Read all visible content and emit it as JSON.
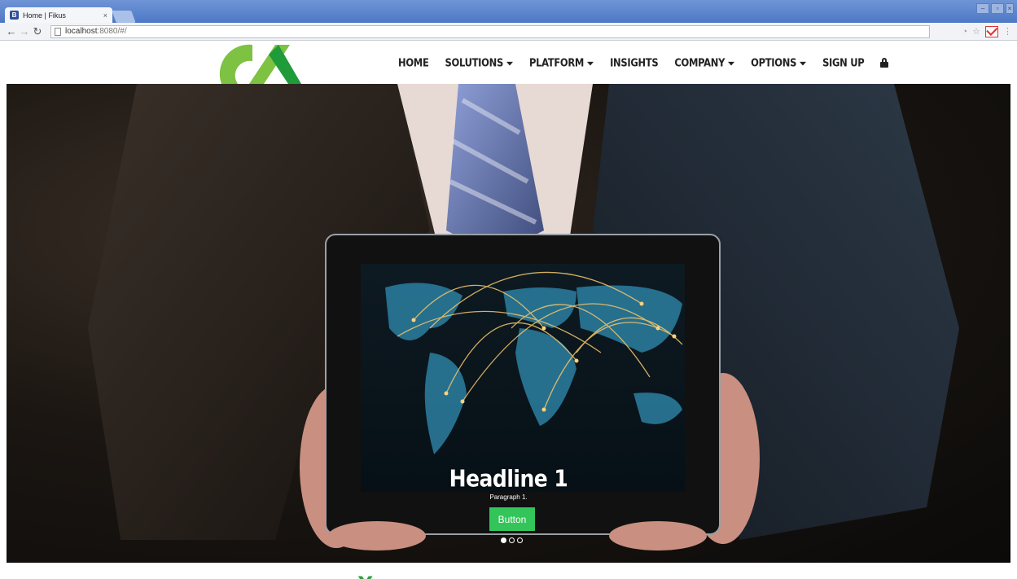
{
  "browser": {
    "tab_title": "Home | Fikus",
    "tab_favicon_letter": "B",
    "tab_close": "×",
    "url_host": "localhost",
    "url_rest": ":8080/#/"
  },
  "nav": {
    "items": [
      {
        "label": "HOME",
        "has_caret": false
      },
      {
        "label": "SOLUTIONS",
        "has_caret": true
      },
      {
        "label": "PLATFORM",
        "has_caret": true
      },
      {
        "label": "INSIGHTS",
        "has_caret": false
      },
      {
        "label": "COMPANY",
        "has_caret": true
      },
      {
        "label": "OPTIONS",
        "has_caret": true
      },
      {
        "label": "SIGN UP",
        "has_caret": false
      }
    ],
    "lock_icon": "lock-icon"
  },
  "brand": {
    "logo_green": "#7dc242",
    "logo_dark_green": "#1f9b3a"
  },
  "hero": {
    "headline": "Headline 1",
    "paragraph": "Paragraph 1.",
    "button_label": "Button",
    "button_color": "#33c45a",
    "slides": 3,
    "active_slide": 1
  },
  "teaser": {
    "text": "Y"
  }
}
